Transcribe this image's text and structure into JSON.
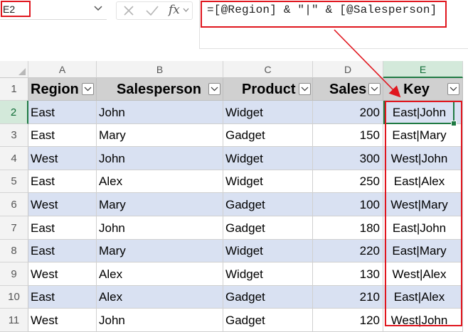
{
  "name_box": {
    "value": "E2"
  },
  "formula_bar": {
    "cancel_icon": "close-icon",
    "enter_icon": "check-icon",
    "function_label": "fx",
    "formula": "=[@Region] & \"|\" & [@Salesperson]"
  },
  "columns": [
    "A",
    "B",
    "C",
    "D",
    "E"
  ],
  "selected_column": "E",
  "selected_row": "2",
  "table": {
    "headers": [
      "Region",
      "Salesperson",
      "Product",
      "Sales",
      "Key"
    ],
    "rows": [
      {
        "row": "2",
        "region": "East",
        "salesperson": "John",
        "product": "Widget",
        "sales": "200",
        "key": "East|John"
      },
      {
        "row": "3",
        "region": "East",
        "salesperson": "Mary",
        "product": "Gadget",
        "sales": "150",
        "key": "East|Mary"
      },
      {
        "row": "4",
        "region": "West",
        "salesperson": "John",
        "product": "Widget",
        "sales": "300",
        "key": "West|John"
      },
      {
        "row": "5",
        "region": "East",
        "salesperson": "Alex",
        "product": "Widget",
        "sales": "250",
        "key": "East|Alex"
      },
      {
        "row": "6",
        "region": "West",
        "salesperson": "Mary",
        "product": "Gadget",
        "sales": "100",
        "key": "West|Mary"
      },
      {
        "row": "7",
        "region": "East",
        "salesperson": "John",
        "product": "Gadget",
        "sales": "180",
        "key": "East|John"
      },
      {
        "row": "8",
        "region": "East",
        "salesperson": "Mary",
        "product": "Widget",
        "sales": "220",
        "key": "East|Mary"
      },
      {
        "row": "9",
        "region": "West",
        "salesperson": "Alex",
        "product": "Widget",
        "sales": "130",
        "key": "West|Alex"
      },
      {
        "row": "10",
        "region": "East",
        "salesperson": "Alex",
        "product": "Gadget",
        "sales": "210",
        "key": "East|Alex"
      },
      {
        "row": "11",
        "region": "West",
        "salesperson": "John",
        "product": "Gadget",
        "sales": "120",
        "key": "West|John"
      }
    ]
  },
  "colors": {
    "highlight_red": "#e0161e",
    "selection_green": "#1f7a43",
    "band_blue": "#d9e1f2",
    "header_gray": "#d0d0d0"
  }
}
